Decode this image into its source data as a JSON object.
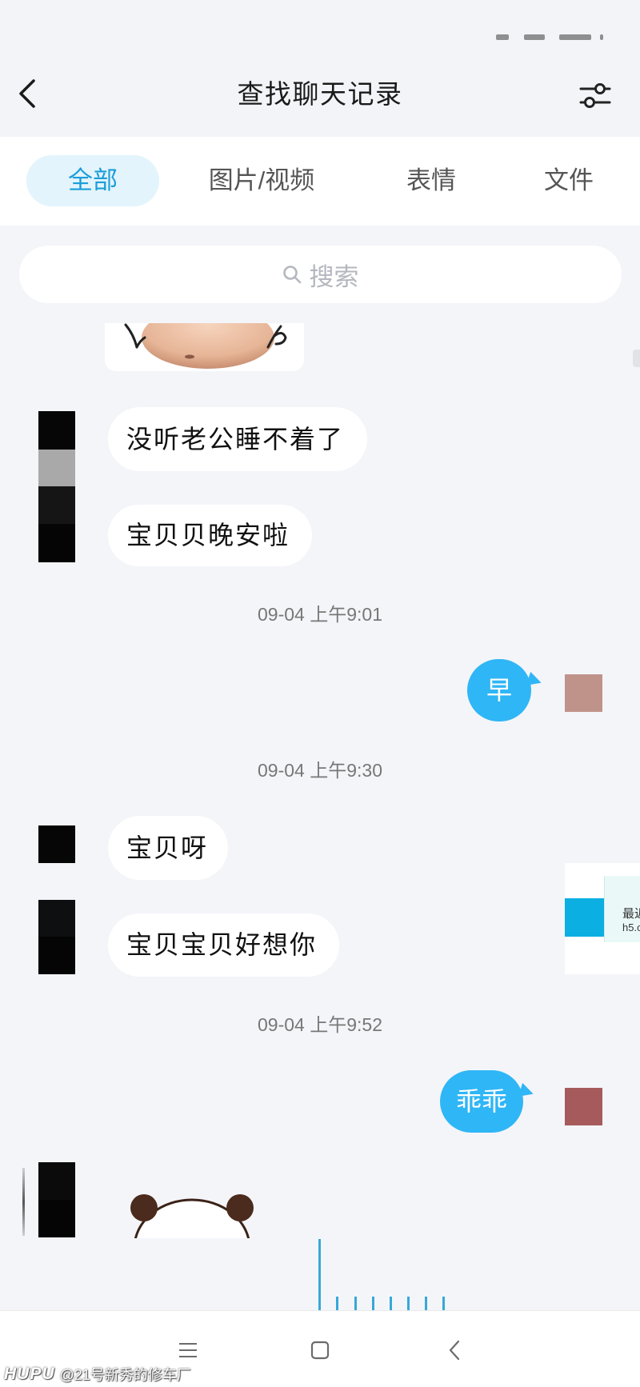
{
  "status_bar": {
    "icons": [
      "signal-icon",
      "wifi-icon",
      "battery-icon"
    ]
  },
  "header": {
    "back_icon": "chevron-left-icon",
    "title": "查找聊天记录",
    "filter_icon": "sliders-icon"
  },
  "tabs": [
    {
      "label": "全部",
      "selected": true
    },
    {
      "label": "图片/视频",
      "selected": false
    },
    {
      "label": "表情",
      "selected": false
    },
    {
      "label": "文件",
      "selected": false
    }
  ],
  "search": {
    "icon": "search-icon",
    "placeholder": "搜索"
  },
  "messages": [
    {
      "outgoing": false,
      "sticker_icon": "belly-sticker"
    },
    {
      "outgoing": false,
      "text": "没听老公睡不着了"
    },
    {
      "outgoing": false,
      "text": "宝贝贝晚安啦"
    },
    {
      "timestamp": "09-04 上午9:01"
    },
    {
      "outgoing": true,
      "text": "早"
    },
    {
      "timestamp": "09-04 上午9:30"
    },
    {
      "outgoing": false,
      "text": "宝贝呀"
    },
    {
      "outgoing": false,
      "text": "宝贝宝贝好想你"
    },
    {
      "timestamp": "09-04 上午9:52"
    },
    {
      "outgoing": true,
      "text": "乖乖"
    },
    {
      "outgoing": false,
      "sticker_icon": "panda-sticker"
    }
  ],
  "avatar_colors": {
    "contact_a": [
      "#060606",
      "#a9a9a9",
      "#151515",
      "#050505"
    ],
    "contact_b": [
      "#060606"
    ],
    "contact_c": [
      "#0e0f10",
      "#050505"
    ],
    "contact_d": [
      "#0b0b0b",
      "#050505"
    ],
    "self_1": "#c0938a",
    "self_2": "#a75a5b"
  },
  "floating_widget": {
    "line1": "最近",
    "line2": "h5.c"
  },
  "nav_bar": {
    "icons": [
      "menu-icon",
      "home-icon",
      "back-icon"
    ]
  },
  "watermark": {
    "brand": "HUPU",
    "handle": "@21号新秀的修车厂"
  },
  "colors": {
    "accent": "#1b9ed8",
    "accent_bg": "#e3f4fc",
    "outgoing_bubble": "#2fb6f6",
    "page_bg": "#f4f5f9",
    "widget_accent": "#0bafe2"
  }
}
